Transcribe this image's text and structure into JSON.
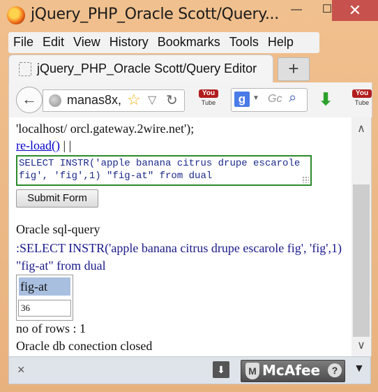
{
  "window": {
    "title": "jQuery_PHP_Oracle Scott/Query...",
    "min": "—",
    "max": "☐",
    "close": "✕"
  },
  "menu": [
    "File",
    "Edit",
    "View",
    "History",
    "Bookmarks",
    "Tools",
    "Help"
  ],
  "tab": {
    "label": "jQuery_PHP_Oracle Scott/Query Editor",
    "new_tab": "+"
  },
  "nav": {
    "back": "←",
    "url": "manas8x,",
    "star": "☆",
    "dropdown": "▽",
    "reload": "↻",
    "youtube_top": "You",
    "youtube_bottom": "Tube",
    "search_engine": "g",
    "search_arrow": "▼",
    "search_placeholder": "Gc",
    "search_icon": "⌕",
    "download_arrow": "⬇"
  },
  "content": {
    "line1": "'localhost/ orcl.gateway.2wire.net');",
    "reload_link": "re-load()",
    "reload_suffix": " | |",
    "sql_text": "SELECT INSTR('apple banana citrus drupe escarole fig', 'fig',1) \"fig-at\" from dual",
    "submit_label": "Submit Form",
    "heading": "Oracle sql-query",
    "query_echo": ":SELECT INSTR('apple banana citrus drupe escarole fig', 'fig',1) \"fig-at\" from dual",
    "table": {
      "header": "fig-at",
      "value": "36"
    },
    "rows": "no of rows : 1",
    "closed": "Oracle db conection closed"
  },
  "addon": {
    "close": "×",
    "download": "⬇",
    "mcafee_logo": "M",
    "mcafee": "McAfee",
    "help": "?",
    "menu": "▼"
  },
  "colors": {
    "titlebar": "#f0c08e",
    "close_button": "#c7514c",
    "link": "#0000cc",
    "sql_border": "#2c8a2c",
    "query_text": "#1a1a8a",
    "table_header": "#a9bfe0"
  }
}
